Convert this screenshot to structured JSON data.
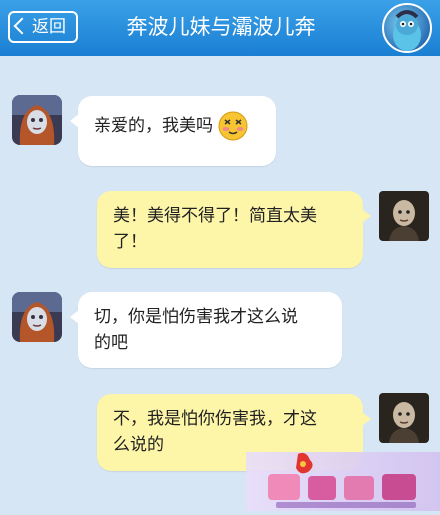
{
  "header": {
    "back_label": "返回",
    "title": "奔波儿妹与灞波儿奔"
  },
  "messages": [
    {
      "side": "left",
      "line1": "亲爱的，我美吗",
      "emoji": "blushing-smile-emoji"
    },
    {
      "side": "right",
      "line1": "美！美得不得了！简直太美",
      "line2": "了！"
    },
    {
      "side": "left",
      "line1": "切，你是怕伤害我才这么说",
      "line2": "的吧"
    },
    {
      "side": "right",
      "line1": "不，我是怕你伤害我，才这",
      "line2": "么说的"
    }
  ],
  "colors": {
    "header_top": "#3aa1e8",
    "header_bottom": "#1a7fd2",
    "background": "#d7e6f5",
    "bubble_left": "#ffffff",
    "bubble_right": "#fdf5a8"
  }
}
